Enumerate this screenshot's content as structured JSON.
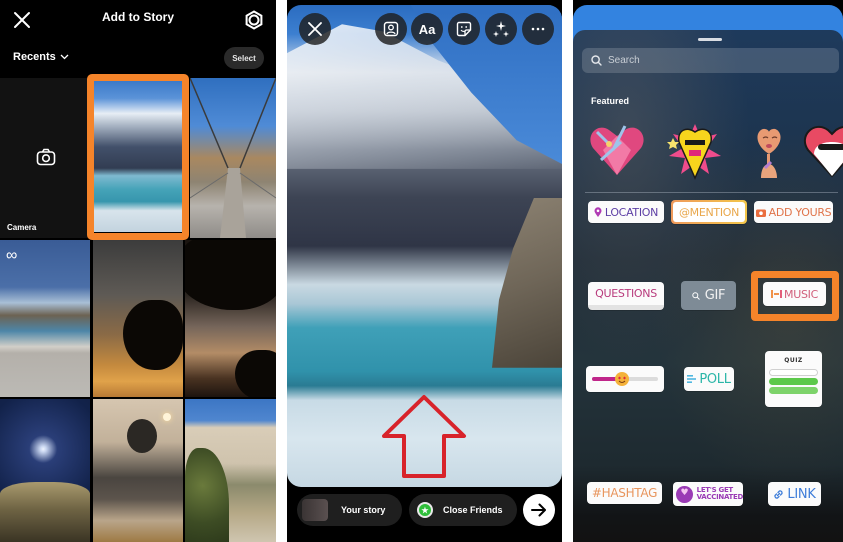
{
  "gallery": {
    "title": "Add to Story",
    "close_icon": "close-icon",
    "settings_icon": "gear-icon",
    "album_label": "Recents",
    "select_label": "Select",
    "camera_label": "Camera",
    "selected_index": 1,
    "tiles": [
      {
        "name": "camera-tile",
        "kind": "camera"
      },
      {
        "name": "mountain-lake-photo",
        "kind": "photo",
        "selected": true
      },
      {
        "name": "suspension-bridge-photo",
        "kind": "photo"
      },
      {
        "name": "glacier-lake-boomerang",
        "kind": "boomerang",
        "badge": "∞"
      },
      {
        "name": "sunset-tree-photo",
        "kind": "photo"
      },
      {
        "name": "dusk-tree-silhouette-photo",
        "kind": "photo"
      },
      {
        "name": "moon-night-photo",
        "kind": "photo"
      },
      {
        "name": "tea-cup-photo",
        "kind": "photo"
      },
      {
        "name": "house-garden-photo",
        "kind": "photo"
      }
    ]
  },
  "editor": {
    "toolbar": [
      {
        "name": "close-button",
        "icon": "close-icon"
      },
      {
        "name": "tag-people-button",
        "icon": "person-tag-icon"
      },
      {
        "name": "text-button",
        "label": "Aa"
      },
      {
        "name": "sticker-button",
        "icon": "sticker-icon"
      },
      {
        "name": "effects-button",
        "icon": "sparkles-icon"
      },
      {
        "name": "more-button",
        "icon": "more-icon",
        "label": "···"
      }
    ],
    "annotation": "red-up-arrow",
    "bottom": {
      "your_story_label": "Your story",
      "close_friends_label": "Close Friends",
      "close_friends_color": "#2fbf3a",
      "next_icon": "arrow-right-icon"
    }
  },
  "sticker_tray": {
    "search_placeholder": "Search",
    "featured_label": "Featured",
    "featured_stickers": [
      "heart-with-flowers-sticker",
      "yellow-mask-sticker",
      "face-mirror-sticker",
      "masked-heart-sticker"
    ],
    "stickers": {
      "location": "LOCATION",
      "mention": "@MENTION",
      "add_yours": "ADD YOURS",
      "questions": "QUESTIONS",
      "gif": "GIF",
      "music": "MUSIC",
      "poll": "POLL",
      "quiz": "QUIZ",
      "hashtag": "#HASHTAG",
      "vaccinated_line1": "LET'S GET",
      "vaccinated_line2": "VACCINATED",
      "link": "LINK"
    },
    "slider_value": 0.45,
    "highlighted": "music"
  },
  "colors": {
    "highlight_orange": "#f5842a",
    "annotation_red": "#d8232a"
  }
}
